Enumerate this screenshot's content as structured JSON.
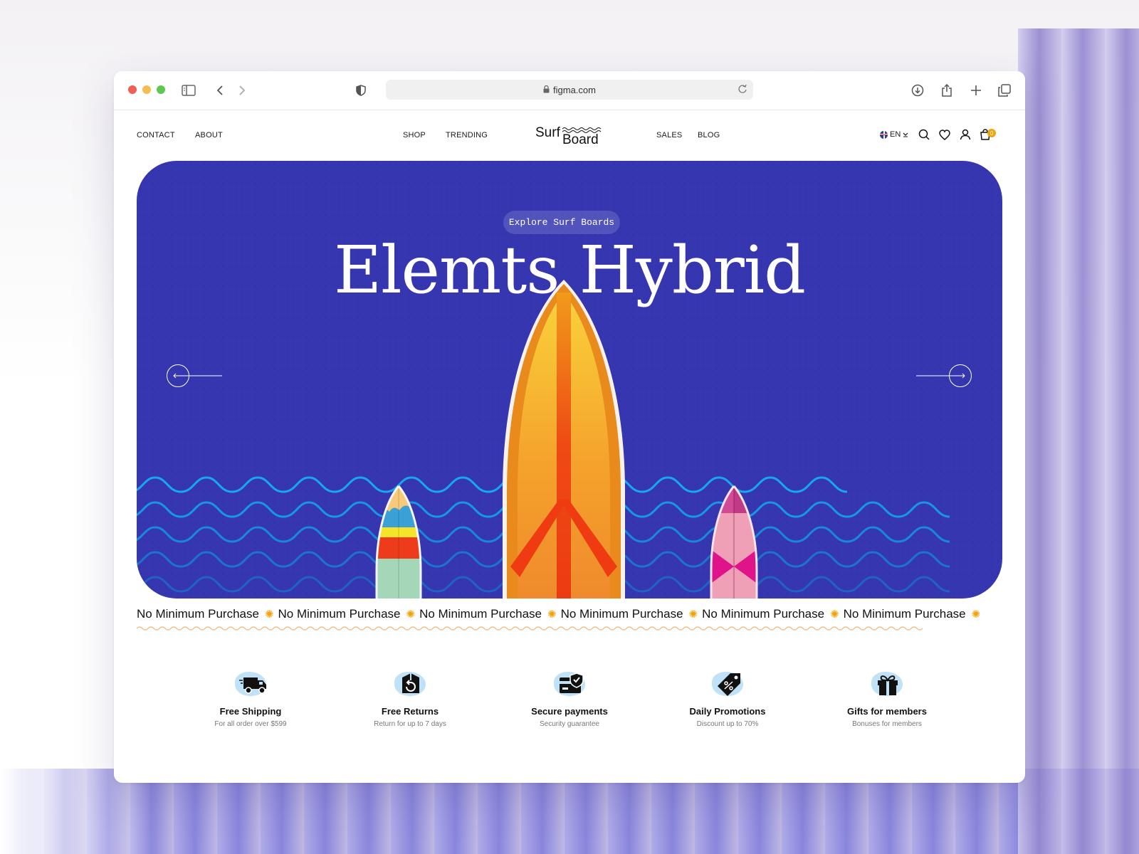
{
  "browser": {
    "url": "figma.com"
  },
  "nav": {
    "contact": "CONTACT",
    "about": "ABOUT",
    "shop": "SHOP",
    "trending": "TRENDING",
    "sales": "SALES",
    "blog": "BLOG",
    "logo_top": "Surf",
    "logo_bottom": "Board",
    "language": "EN",
    "cart_count": "0"
  },
  "hero": {
    "pill_label": "Explore Surf Boards",
    "title": "Elemts Hybrid",
    "colors": {
      "background": "#3637b0",
      "wave": "#1aa3e8",
      "accent": "#f0a30a"
    }
  },
  "marquee": {
    "items": [
      "No Minimum Purchase",
      "No Minimum Purchase",
      "No Minimum Purchase",
      "No Minimum Purchase",
      "No Minimum Purchase",
      "No Minimum Purchase"
    ]
  },
  "features": [
    {
      "icon": "truck-icon",
      "title": "Free Shipping",
      "subtitle": "For all order over $599"
    },
    {
      "icon": "return-box-icon",
      "title": "Free Returns",
      "subtitle": "Return for up to 7 days"
    },
    {
      "icon": "secure-card-icon",
      "title": "Secure payments",
      "subtitle": "Security guarantee"
    },
    {
      "icon": "discount-tag-icon",
      "title": "Daily Promotions",
      "subtitle": "Discount up to 70%"
    },
    {
      "icon": "gift-icon",
      "title": "Gifts for members",
      "subtitle": "Bonuses for members"
    }
  ]
}
